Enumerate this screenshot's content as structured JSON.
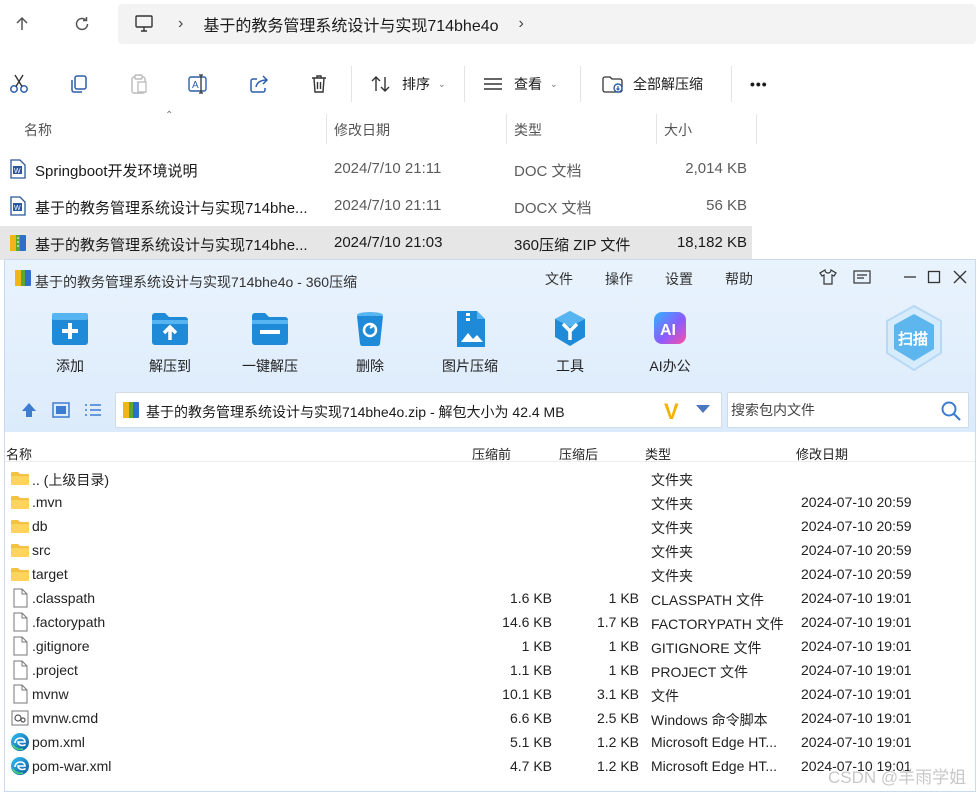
{
  "explorer": {
    "breadcrumb": "基于的教务管理系统设计与实现714bhe4o",
    "toolbar": {
      "sort_label": "排序",
      "view_label": "查看",
      "extract_all_label": "全部解压缩",
      "more_label": "•••"
    },
    "columns": {
      "name": "名称",
      "modified": "修改日期",
      "type": "类型",
      "size": "大小"
    },
    "files": [
      {
        "name": "Springboot开发环境说明",
        "modified": "2024/7/10 21:11",
        "type": "DOC 文档",
        "size": "2,014 KB",
        "icon": "word-doc-icon"
      },
      {
        "name": "基于的教务管理系统设计与实现714bhe...",
        "modified": "2024/7/10 21:11",
        "type": "DOCX 文档",
        "size": "56 KB",
        "icon": "word-docx-icon"
      },
      {
        "name": "基于的教务管理系统设计与实现714bhe...",
        "modified": "2024/7/10 21:03",
        "type": "360压缩 ZIP 文件",
        "size": "18,182 KB",
        "icon": "zip-archive-icon"
      }
    ]
  },
  "zip": {
    "title": "基于的教务管理系统设计与实现714bhe4o - 360压缩",
    "menu": [
      "文件",
      "操作",
      "设置",
      "帮助"
    ],
    "tools": [
      {
        "label": "添加",
        "icon": "add-icon"
      },
      {
        "label": "解压到",
        "icon": "extract-to-icon"
      },
      {
        "label": "一键解压",
        "icon": "one-click-extract-icon"
      },
      {
        "label": "删除",
        "icon": "delete-icon"
      },
      {
        "label": "图片压缩",
        "icon": "image-compress-icon"
      },
      {
        "label": "工具",
        "icon": "tools-icon"
      },
      {
        "label": "AI办公",
        "icon": "ai-office-icon"
      }
    ],
    "scan_label": "扫描",
    "ai_badge": "AI",
    "path": "基于的教务管理系统设计与实现714bhe4o.zip - 解包大小为 42.4 MB",
    "search_placeholder": "搜索包内文件",
    "columns": {
      "name": "名称",
      "before": "压缩前",
      "after": "压缩后",
      "type": "类型",
      "modified": "修改日期"
    },
    "rows": [
      {
        "name": ".. (上级目录)",
        "before": "",
        "after": "",
        "type": "文件夹",
        "modified": "",
        "icon": "folder-icon"
      },
      {
        "name": ".mvn",
        "before": "",
        "after": "",
        "type": "文件夹",
        "modified": "2024-07-10 20:59",
        "icon": "folder-icon"
      },
      {
        "name": "db",
        "before": "",
        "after": "",
        "type": "文件夹",
        "modified": "2024-07-10 20:59",
        "icon": "folder-icon"
      },
      {
        "name": "src",
        "before": "",
        "after": "",
        "type": "文件夹",
        "modified": "2024-07-10 20:59",
        "icon": "folder-icon"
      },
      {
        "name": "target",
        "before": "",
        "after": "",
        "type": "文件夹",
        "modified": "2024-07-10 20:59",
        "icon": "folder-icon"
      },
      {
        "name": ".classpath",
        "before": "1.6 KB",
        "after": "1 KB",
        "type": "CLASSPATH 文件",
        "modified": "2024-07-10 19:01",
        "icon": "file-icon"
      },
      {
        "name": ".factorypath",
        "before": "14.6 KB",
        "after": "1.7 KB",
        "type": "FACTORYPATH 文件",
        "modified": "2024-07-10 19:01",
        "icon": "file-icon"
      },
      {
        "name": ".gitignore",
        "before": "1 KB",
        "after": "1 KB",
        "type": "GITIGNORE 文件",
        "modified": "2024-07-10 19:01",
        "icon": "file-icon"
      },
      {
        "name": ".project",
        "before": "1.1 KB",
        "after": "1 KB",
        "type": "PROJECT 文件",
        "modified": "2024-07-10 19:01",
        "icon": "file-icon"
      },
      {
        "name": "mvnw",
        "before": "10.1 KB",
        "after": "3.1 KB",
        "type": "文件",
        "modified": "2024-07-10 19:01",
        "icon": "file-icon"
      },
      {
        "name": "mvnw.cmd",
        "before": "6.6 KB",
        "after": "2.5 KB",
        "type": "Windows 命令脚本",
        "modified": "2024-07-10 19:01",
        "icon": "cmd-script-icon"
      },
      {
        "name": "pom.xml",
        "before": "5.1 KB",
        "after": "1.2 KB",
        "type": "Microsoft Edge HT...",
        "modified": "2024-07-10 19:01",
        "icon": "edge-icon"
      },
      {
        "name": "pom-war.xml",
        "before": "4.7 KB",
        "after": "1.2 KB",
        "type": "Microsoft Edge HT...",
        "modified": "2024-07-10 19:01",
        "icon": "edge-icon"
      }
    ]
  },
  "watermark": "CSDN @羊雨学姐"
}
